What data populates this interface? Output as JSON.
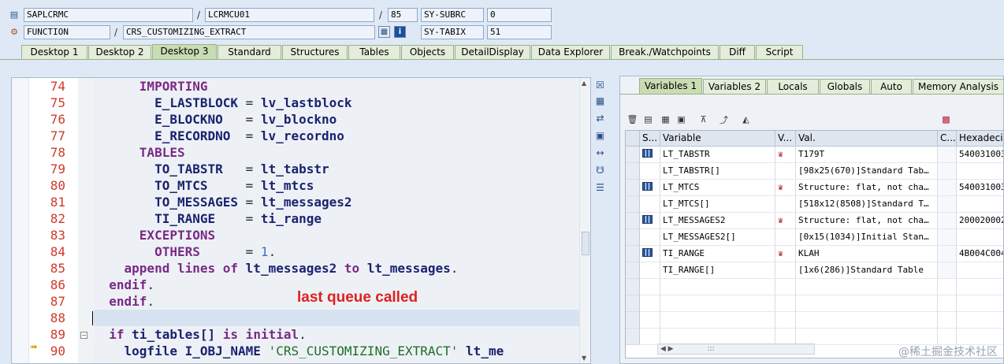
{
  "header": {
    "row1": {
      "program": "SAPLCRMC",
      "include": "LCRMCU01",
      "line": "85",
      "sysvar_name": "SY-SUBRC",
      "sysvar_value": "0"
    },
    "row2": {
      "event_type": "FUNCTION",
      "event_name": "CRS_CUSTOMIZING_EXTRACT",
      "sysvar_name": "SY-TABIX",
      "sysvar_value": "51"
    }
  },
  "tabs": [
    "Desktop 1",
    "Desktop 2",
    "Desktop 3",
    "Standard",
    "Structures",
    "Tables",
    "Objects",
    "DetailDisplay",
    "Data Explorer",
    "Break./Watchpoints",
    "Diff",
    "Script"
  ],
  "active_tab": "Desktop 3",
  "editor": {
    "current_line": "85",
    "annotation": "last queue called",
    "lines": [
      {
        "n": "74",
        "parts": [
          {
            "t": "      "
          },
          {
            "t": "IMPORTING",
            "c": "kw"
          }
        ]
      },
      {
        "n": "75",
        "parts": [
          {
            "t": "        "
          },
          {
            "t": "E_LASTBLOCK",
            "c": "id"
          },
          {
            "t": " = "
          },
          {
            "t": "lv_lastblock",
            "c": "id"
          }
        ]
      },
      {
        "n": "76",
        "parts": [
          {
            "t": "        "
          },
          {
            "t": "E_BLOCKNO",
            "c": "id"
          },
          {
            "t": "   = "
          },
          {
            "t": "lv_blockno",
            "c": "id"
          }
        ]
      },
      {
        "n": "77",
        "parts": [
          {
            "t": "        "
          },
          {
            "t": "E_RECORDNO",
            "c": "id"
          },
          {
            "t": "  = "
          },
          {
            "t": "lv_recordno",
            "c": "id"
          }
        ]
      },
      {
        "n": "78",
        "parts": [
          {
            "t": "      "
          },
          {
            "t": "TABLES",
            "c": "kw"
          }
        ]
      },
      {
        "n": "79",
        "parts": [
          {
            "t": "        "
          },
          {
            "t": "TO_TABSTR",
            "c": "id"
          },
          {
            "t": "   = "
          },
          {
            "t": "lt_tabstr",
            "c": "id"
          }
        ]
      },
      {
        "n": "80",
        "parts": [
          {
            "t": "        "
          },
          {
            "t": "TO_MTCS",
            "c": "id"
          },
          {
            "t": "     = "
          },
          {
            "t": "lt_mtcs",
            "c": "id"
          }
        ]
      },
      {
        "n": "81",
        "parts": [
          {
            "t": "        "
          },
          {
            "t": "TO_MESSAGES",
            "c": "id"
          },
          {
            "t": " = "
          },
          {
            "t": "lt_messages2",
            "c": "id"
          }
        ]
      },
      {
        "n": "82",
        "parts": [
          {
            "t": "        "
          },
          {
            "t": "TI_RANGE",
            "c": "id"
          },
          {
            "t": "    = "
          },
          {
            "t": "ti_range",
            "c": "id"
          }
        ]
      },
      {
        "n": "83",
        "parts": [
          {
            "t": "      "
          },
          {
            "t": "EXCEPTIONS",
            "c": "kw"
          }
        ]
      },
      {
        "n": "84",
        "parts": [
          {
            "t": "        "
          },
          {
            "t": "OTHERS",
            "c": "kw"
          },
          {
            "t": "      = "
          },
          {
            "t": "1",
            "c": "num"
          },
          {
            "t": "."
          }
        ]
      },
      {
        "n": "85",
        "parts": [
          {
            "t": "    "
          },
          {
            "t": "append lines of",
            "c": "kw"
          },
          {
            "t": " "
          },
          {
            "t": "lt_messages2",
            "c": "id"
          },
          {
            "t": " "
          },
          {
            "t": "to",
            "c": "kw"
          },
          {
            "t": " "
          },
          {
            "t": "lt_messages",
            "c": "id"
          },
          {
            "t": "."
          }
        ]
      },
      {
        "n": "86",
        "parts": [
          {
            "t": "  "
          },
          {
            "t": "endif",
            "c": "kw"
          },
          {
            "t": "."
          }
        ]
      },
      {
        "n": "87",
        "parts": [
          {
            "t": "  "
          },
          {
            "t": "endif",
            "c": "kw"
          },
          {
            "t": "."
          }
        ]
      },
      {
        "n": "88",
        "parts": [
          {
            "t": ""
          }
        ]
      },
      {
        "n": "89",
        "parts": [
          {
            "t": "  "
          },
          {
            "t": "if",
            "c": "kw"
          },
          {
            "t": " "
          },
          {
            "t": "ti_tables[]",
            "c": "id"
          },
          {
            "t": " "
          },
          {
            "t": "is initial",
            "c": "kw"
          },
          {
            "t": "."
          }
        ]
      },
      {
        "n": "90",
        "parts": [
          {
            "t": "    "
          },
          {
            "t": "logfile",
            "c": "id"
          },
          {
            "t": " "
          },
          {
            "t": "I_OBJ_NAME",
            "c": "id"
          },
          {
            "t": " "
          },
          {
            "t": "'CRS_CUSTOMIZING_EXTRACT'",
            "c": "str"
          },
          {
            "t": " "
          },
          {
            "t": "lt_me",
            "c": "id"
          }
        ]
      }
    ]
  },
  "rpanel": {
    "tabs": [
      "Variables 1",
      "Variables 2",
      "Locals",
      "Globals",
      "Auto",
      "Memory Analysis"
    ],
    "active_tab": "Variables 1",
    "columns": [
      "S...",
      "Variable",
      "V...",
      "Val.",
      "C...",
      "Hexadecimal"
    ],
    "rows": [
      {
        "icon": "table",
        "variable": "LT_TABSTR",
        "vicon": "hat",
        "value": "T179T",
        "hex": "540031003"
      },
      {
        "icon": "",
        "variable": "LT_TABSTR[]",
        "vicon": "",
        "value": "[98x25(670)]Standard Tab…",
        "hex": ""
      },
      {
        "icon": "table",
        "variable": "LT_MTCS",
        "vicon": "hat",
        "value": "Structure: flat, not cha…",
        "hex": "540031003"
      },
      {
        "icon": "",
        "variable": "LT_MTCS[]",
        "vicon": "",
        "value": "[518x12(8508)]Standard T…",
        "hex": ""
      },
      {
        "icon": "table",
        "variable": "LT_MESSAGES2",
        "vicon": "hat",
        "value": "Structure: flat, not cha…",
        "hex": "200020002"
      },
      {
        "icon": "",
        "variable": "LT_MESSAGES2[]",
        "vicon": "",
        "value": "[0x15(1034)]Initial Stan…",
        "hex": ""
      },
      {
        "icon": "table",
        "variable": "TI_RANGE",
        "vicon": "hat",
        "value": "KLAH",
        "hex": "4B004C004"
      },
      {
        "icon": "",
        "variable": "TI_RANGE[]",
        "vicon": "",
        "value": "[1x6(286)]Standard Table",
        "hex": ""
      }
    ]
  },
  "watermark": "@稀土掘金技术社区"
}
